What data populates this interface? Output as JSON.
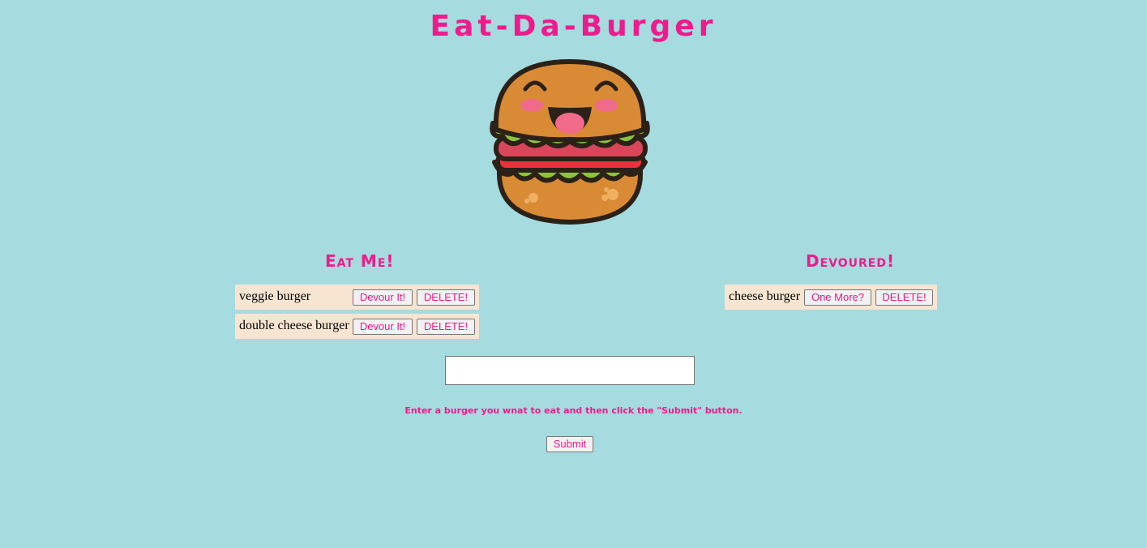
{
  "header": {
    "title": "Eat-Da-Burger"
  },
  "logo": {
    "icon": "burger-icon"
  },
  "eat_me": {
    "heading": "Eat Me!",
    "items": [
      {
        "name": "veggie burger",
        "devour_label": "Devour It!",
        "delete_label": "DELETE!"
      },
      {
        "name": "double cheese burger",
        "devour_label": "Devour It!",
        "delete_label": "DELETE!"
      }
    ]
  },
  "devoured": {
    "heading": "Devoured!",
    "items": [
      {
        "name": "cheese burger",
        "more_label": "One More?",
        "delete_label": "DELETE!"
      }
    ]
  },
  "form": {
    "input_value": "",
    "hint": "Enter a burger you wnat to eat and then click the \"Submit\" button.",
    "submit_label": "Submit"
  },
  "colors": {
    "background": "#a6dbe0",
    "accent": "#f01a8c",
    "row_bg": "#f7e5d2"
  }
}
